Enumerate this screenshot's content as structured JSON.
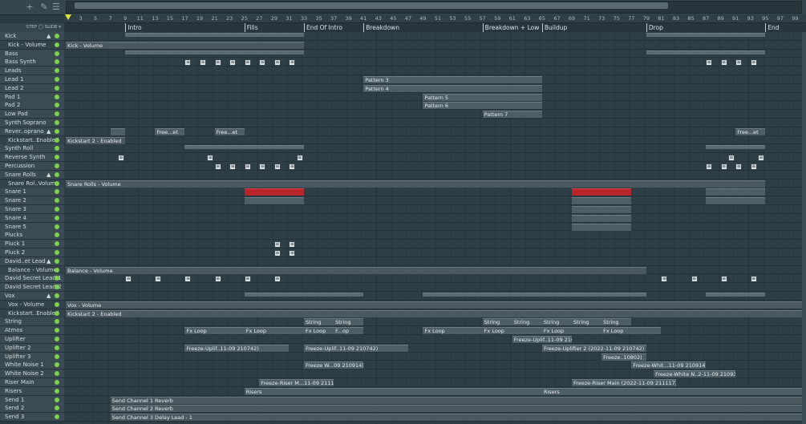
{
  "toolbar": {
    "tools": [
      "+",
      "✎",
      "☰"
    ],
    "step_label": "STEP",
    "slide_label": "SLIDE"
  },
  "ruler": {
    "bars": [
      "3",
      "5",
      "7",
      "9",
      "11",
      "13",
      "15",
      "17",
      "19",
      "21",
      "23",
      "25",
      "27",
      "29",
      "31",
      "33",
      "35",
      "37",
      "39",
      "41",
      "43",
      "45",
      "47",
      "49",
      "51",
      "53",
      "55",
      "57",
      "59",
      "61",
      "63",
      "65",
      "67",
      "69",
      "71",
      "73",
      "75",
      "77",
      "79",
      "81",
      "83",
      "85",
      "87",
      "89",
      "91",
      "93",
      "95",
      "97",
      "99"
    ]
  },
  "markers": [
    "Intro",
    "Fills",
    "End Of Intro",
    "Breakdown",
    "Breakdown + Low",
    "Buildup",
    "Drop",
    "End"
  ],
  "tracks": [
    {
      "name": "Kick",
      "fold": "▲"
    },
    {
      "name": "Kick - Volume",
      "auto": true
    },
    {
      "name": "Bass"
    },
    {
      "name": "Bass Synth"
    },
    {
      "name": "Leads"
    },
    {
      "name": "Lead 1"
    },
    {
      "name": "Lead 2"
    },
    {
      "name": "Pad 1"
    },
    {
      "name": "Pad 2"
    },
    {
      "name": "Low Pad"
    },
    {
      "name": "Synth Soprano"
    },
    {
      "name": "Rever..oprano",
      "fold": "▲"
    },
    {
      "name": "Kickstart..Enabled",
      "auto": true
    },
    {
      "name": "Synth Roll"
    },
    {
      "name": "Reverse Synth"
    },
    {
      "name": "Percussion"
    },
    {
      "name": "Snare Rolls",
      "fold": "▲"
    },
    {
      "name": "Snare Rol..Volume",
      "auto": true
    },
    {
      "name": "Snare 1"
    },
    {
      "name": "Snare 2"
    },
    {
      "name": "Snare 3"
    },
    {
      "name": "Snare 4"
    },
    {
      "name": "Snare 5"
    },
    {
      "name": "Plucks"
    },
    {
      "name": "Pluck 1"
    },
    {
      "name": "Pluck 2"
    },
    {
      "name": "David..et Lead",
      "fold": "▲"
    },
    {
      "name": "Balance - Volume",
      "auto": true
    },
    {
      "name": "David Secret Lead 1"
    },
    {
      "name": "David Secret Lead 2"
    },
    {
      "name": "Vox",
      "fold": "▲"
    },
    {
      "name": "Vox - Volume",
      "auto": true
    },
    {
      "name": "Kickstart..Enabled",
      "auto": true
    },
    {
      "name": "String"
    },
    {
      "name": "Atmos"
    },
    {
      "name": "Uplifter"
    },
    {
      "name": "Uplifter 2"
    },
    {
      "name": "Uplifter 3"
    },
    {
      "name": "White Noise 1"
    },
    {
      "name": "White Noise 2"
    },
    {
      "name": "Riser Main"
    },
    {
      "name": "Risers"
    },
    {
      "name": "Send 1"
    },
    {
      "name": "Send 2"
    },
    {
      "name": "Send 3"
    }
  ],
  "clips": {
    "kick_volume": "Kick - Volume",
    "pattern3": "Pattern 3",
    "pattern4": "Pattern 4",
    "pattern5": "Pattern 5",
    "pattern6": "Pattern 6",
    "pattern7": "Pattern 7",
    "free_et": "Free...et",
    "kickstart2": "Kickstart 2 - Enabled",
    "snare_rolls_volume": "Snare Rolls - Volume",
    "balance_volume": "Balance - Volume",
    "vox_volume": "Vox - Volume",
    "string": "String",
    "fx_loop": "Fx Loop",
    "f_op": "F...op",
    "freeze_uplif_a": "Freeze-Uplif..11-09 210742)",
    "freeze_uplif_b": "Freeze-Uplif..11-09 210742)",
    "freeze_uplif_c": "Freeze-Uplif..11-09 210651)",
    "freeze_uplifter2": "Freeze-Uplifter 2 (2022-11-09 210742)",
    "freeze_3": "Freeze..10802)",
    "freeze_w": "Freeze W...09 210914)",
    "freeze_whit": "Freeze-Whit...11-09 210914)",
    "freeze_white_n": "Freeze-White N..2-11-09 210935)",
    "freeze_riser_m": "Freeze-Riser M...11-09 211117)",
    "freeze_riser_main": "Freeze-Riser Main (2022-11-09 211117)",
    "risers": "Risers",
    "send1": "Send Channel 1 Reverb",
    "send2": "Send Channel 2 Reverb",
    "send3": "Send Channel 3 Delay Lead - 1"
  }
}
